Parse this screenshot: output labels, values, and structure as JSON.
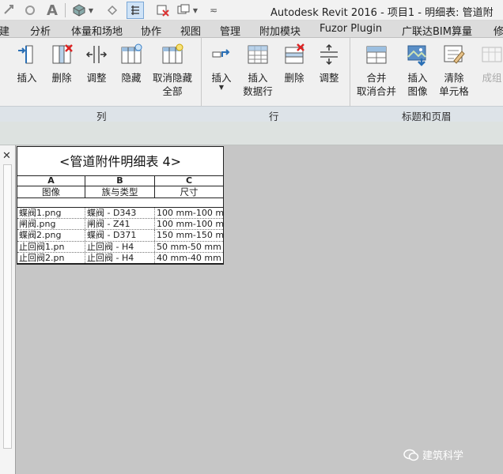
{
  "window": {
    "title": "Autodesk Revit 2016 -    项目1 - 明细表: 管道附"
  },
  "menu": {
    "tabs": [
      "构建",
      "分析",
      "体量和场地",
      "协作",
      "视图",
      "管理",
      "附加模块",
      "Fuzor Plugin",
      "广联达BIM算量",
      "修"
    ]
  },
  "ribbon": {
    "column_panel": {
      "title": "列",
      "buttons": [
        {
          "label": "插入"
        },
        {
          "label": "删除"
        },
        {
          "label": "调整"
        },
        {
          "label": "隐藏"
        },
        {
          "label": "取消隐藏",
          "label2": "全部"
        }
      ]
    },
    "row_panel": {
      "title": "行",
      "buttons": [
        {
          "label": "插入"
        },
        {
          "label": "插入",
          "label2": "数据行"
        },
        {
          "label": "删除"
        },
        {
          "label": "调整"
        }
      ]
    },
    "header_panel": {
      "title": "标题和页眉",
      "buttons": [
        {
          "label": "合并",
          "label2": "取消合并"
        },
        {
          "label": "插入",
          "label2": "图像"
        },
        {
          "label": "清除",
          "label2": "单元格"
        },
        {
          "label": "成组"
        }
      ]
    }
  },
  "schedule": {
    "title": "<管道附件明细表 4>",
    "col_letters": [
      "A",
      "B",
      "C"
    ],
    "col_headers": [
      "图像",
      "族与类型",
      "尺寸"
    ],
    "rows": [
      [
        "蝶阀1.png",
        "蝶阀 - D343",
        "100 mm-100 m"
      ],
      [
        "闸阀.png",
        "闸阀 - Z41",
        "100 mm-100 m"
      ],
      [
        "蝶阀2.png",
        "蝶阀 - D371",
        "150 mm-150 m"
      ],
      [
        "止回阀1.pn",
        "止回阀 - H4",
        "50 mm-50 mm"
      ],
      [
        "止回阀2.pn",
        "止回阀 - H4",
        "40 mm-40 mm"
      ]
    ]
  },
  "watermark": {
    "text": "建筑科学"
  },
  "colors": {
    "ribbon_bg": "#f0f0f0",
    "canvas_bg": "#c6c6c6",
    "panel_strip": "#dde3e8"
  }
}
